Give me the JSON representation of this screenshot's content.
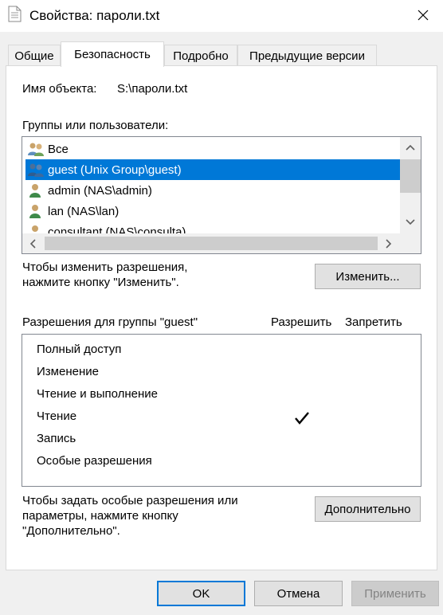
{
  "window": {
    "title": "Свойства: пароли.txt",
    "close_glyph": "✕"
  },
  "tabs": [
    {
      "label": "Общие"
    },
    {
      "label": "Безопасность"
    },
    {
      "label": "Подробно"
    },
    {
      "label": "Предыдущие версии"
    }
  ],
  "security": {
    "object_name_label": "Имя объекта:",
    "object_name_value": "S:\\пароли.txt",
    "groups_label": "Группы или пользователи:",
    "users": [
      {
        "name": "Все",
        "icon": "group-icon"
      },
      {
        "name": "guest (Unix Group\\guest)",
        "icon": "group-icon",
        "selected": true
      },
      {
        "name": "admin (NAS\\admin)",
        "icon": "user-icon"
      },
      {
        "name": "lan (NAS\\lan)",
        "icon": "user-icon"
      },
      {
        "name": "consultant (NAS\\consulta)",
        "icon": "user-icon"
      }
    ],
    "change_hint_line1": "Чтобы изменить разрешения,",
    "change_hint_line2": "нажмите кнопку \"Изменить\".",
    "change_button": "Изменить...",
    "permissions_label": "Разрешения для группы \"guest\"",
    "allow_header": "Разрешить",
    "deny_header": "Запретить",
    "permissions": [
      {
        "name": "Полный доступ",
        "allow": false,
        "deny": false
      },
      {
        "name": "Изменение",
        "allow": false,
        "deny": false
      },
      {
        "name": "Чтение и выполнение",
        "allow": false,
        "deny": false
      },
      {
        "name": "Чтение",
        "allow": true,
        "deny": false
      },
      {
        "name": "Запись",
        "allow": false,
        "deny": false
      },
      {
        "name": "Особые разрешения",
        "allow": false,
        "deny": false
      }
    ],
    "advanced_hint_line1": "Чтобы задать особые разрешения или",
    "advanced_hint_line2": "параметры, нажмите кнопку",
    "advanced_hint_line3": "\"Дополнительно\".",
    "advanced_button": "Дополнительно"
  },
  "footer": {
    "ok": "OK",
    "cancel": "Отмена",
    "apply": "Применить"
  },
  "colors": {
    "selection": "#0078d7",
    "dialog_bg": "#f0f0f0",
    "default_button_border": "#0078d7"
  }
}
